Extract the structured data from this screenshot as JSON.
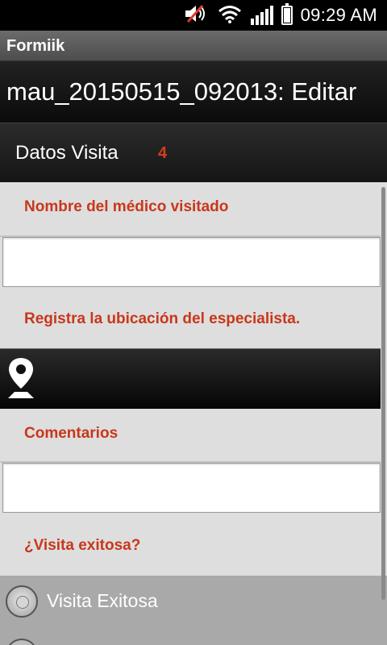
{
  "status_bar": {
    "time": "09:29 AM",
    "icons": [
      "mute-icon",
      "wifi-icon",
      "signal-icon",
      "battery-icon"
    ]
  },
  "app": {
    "name": "Formiik"
  },
  "header": {
    "title": "mau_20150515_092013: Editar"
  },
  "section": {
    "title": "Datos Visita",
    "count": "4"
  },
  "form": {
    "doctor_label": "Nombre del médico visitado",
    "doctor_value": "",
    "location_label": "Registra la ubicación del especialista.",
    "location_icon": "location-pin-icon",
    "comments_label": "Comentarios",
    "comments_value": "",
    "success_label": "¿Visita exitosa?",
    "options": [
      {
        "label": "Visita Exitosa",
        "selected": false
      }
    ]
  },
  "colors": {
    "accent": "#c8371b",
    "background": "#dedede",
    "dark_bar": "#111111"
  }
}
